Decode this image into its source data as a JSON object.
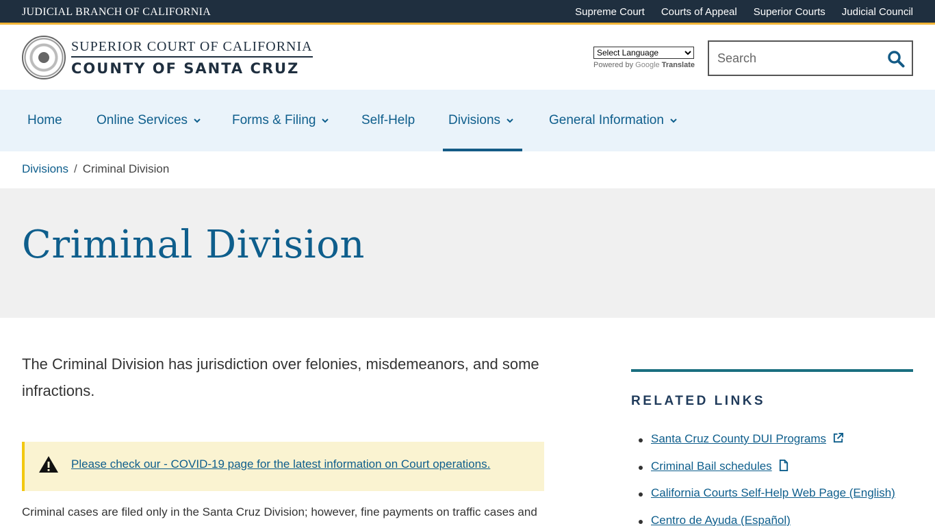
{
  "topbar": {
    "brand": "JUDICIAL BRANCH OF CALIFORNIA",
    "links": [
      "Supreme Court",
      "Courts of Appeal",
      "Superior Courts",
      "Judicial Council"
    ]
  },
  "header": {
    "title_line1": "SUPERIOR COURT OF CALIFORNIA",
    "title_line2": "COUNTY OF SANTA CRUZ",
    "translate_select": "Select Language",
    "powered_by": "Powered by",
    "google": "Google",
    "translate": "Translate",
    "search_placeholder": "Search"
  },
  "nav": {
    "items": [
      {
        "label": "Home"
      },
      {
        "label": "Online Services"
      },
      {
        "label": "Forms & Filing"
      },
      {
        "label": "Self-Help"
      },
      {
        "label": "Divisions"
      },
      {
        "label": "General Information"
      }
    ]
  },
  "breadcrumb": {
    "parent": "Divisions",
    "separator": "/",
    "current": "Criminal Division"
  },
  "page": {
    "title": "Criminal Division",
    "intro": "The Criminal Division has jurisdiction over felonies, misdemeanors, and some infractions.",
    "alert_link": "Please check our - COVID-19 page for the latest information on Court operations.",
    "body": "Criminal cases are filed only in the Santa Cruz Division; however, fine payments on traffic cases and"
  },
  "related": {
    "heading": "RELATED LINKS",
    "links": [
      {
        "label": "Santa Cruz County DUI Programs",
        "icon": "external-link-icon"
      },
      {
        "label": "Criminal Bail schedules",
        "icon": "document-icon"
      },
      {
        "label": "California Courts Self-Help Web Page (English)",
        "icon": ""
      },
      {
        "label": "Centro de Ayuda (Español)",
        "icon": ""
      }
    ]
  },
  "colors": {
    "topbar": "#1f2f3f",
    "accent_gold": "#f2b535",
    "link_blue": "#0e5e8c",
    "nav_bg": "#eaf3fa",
    "alert_bg": "#faf3d1",
    "teal_rule": "#1a6f80"
  }
}
